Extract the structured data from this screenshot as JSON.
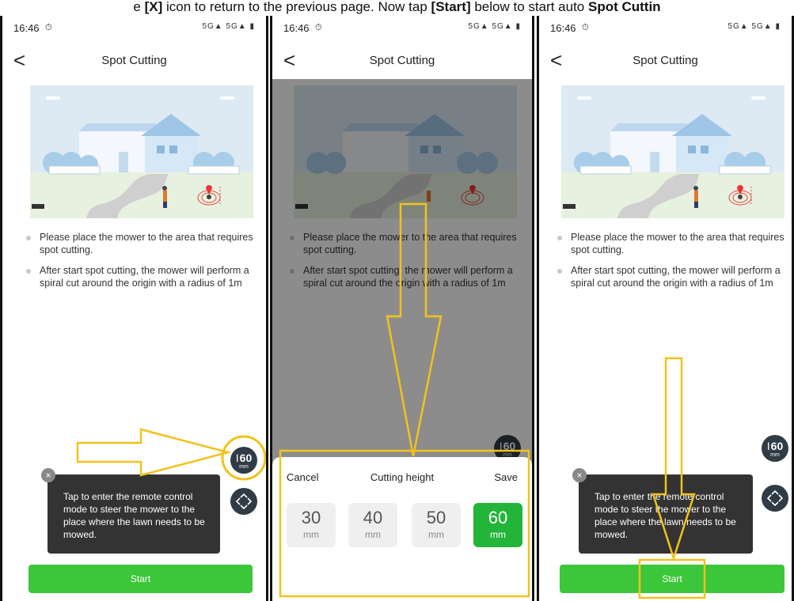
{
  "caption": {
    "part1": "e ",
    "part2": "[X]",
    "part3": " icon to return to the previous page. Now tap ",
    "part4": "[Start]",
    "part5": " below to start auto ",
    "part6": "Spot Cuttin"
  },
  "screens": [
    {
      "time": "16:46",
      "signal": "5G▲ 5G▲ ▮",
      "back_glyph": "<",
      "title": "Spot Cutting",
      "bullets": [
        "Please place the mower to the area that requires spot cutting.",
        "After start spot cutting, the mower will perform a spiral cut around the origin with a radius of 1m"
      ],
      "height_button": {
        "value": "60",
        "unit": "mm"
      },
      "tooltip": {
        "close": "×",
        "text": "Tap to enter the remote control mode to steer the mower to the place where the lawn needs to be mowed."
      },
      "start_label": "Start"
    },
    {
      "time": "16:46",
      "signal": "5G▲ 5G▲ ▮",
      "back_glyph": "<",
      "title": "Spot Cutting",
      "bullets": [
        "Please place the mower to the area that requires spot cutting.",
        "After start spot cutting, the mower will perform a spiral cut around the origin with a radius of 1m"
      ],
      "height_button": {
        "value": "60",
        "unit": "mm"
      },
      "sheet": {
        "cancel": "Cancel",
        "title": "Cutting height",
        "save": "Save",
        "options": [
          {
            "value": "30",
            "unit": "mm"
          },
          {
            "value": "40",
            "unit": "mm"
          },
          {
            "value": "50",
            "unit": "mm"
          },
          {
            "value": "60",
            "unit": "mm"
          }
        ],
        "selected": "60"
      }
    },
    {
      "time": "16:46",
      "signal": "5G▲ 5G▲ ▮",
      "back_glyph": "<",
      "title": "Spot Cutting",
      "bullets": [
        "Please place the mower to the area that requires spot cutting.",
        "After start spot cutting, the mower will perform a spiral cut around the origin with a radius of 1m"
      ],
      "height_button": {
        "value": "60",
        "unit": "mm"
      },
      "tooltip": {
        "close": "×",
        "text": "Tap to enter the remote control mode to steer the mower to the place where the lawn needs to be mowed."
      },
      "start_label": "Start"
    }
  ],
  "colors": {
    "accent_green": "#3cc63a",
    "selected_green": "#22b53a",
    "annotation_yellow": "#f2c21b",
    "fab_dark": "#2f3b45"
  },
  "icons": [
    "back-arrow-icon",
    "alarm-icon",
    "signal-icon",
    "battery-icon",
    "height-icon",
    "joystick-icon",
    "close-icon",
    "location-pin-icon"
  ]
}
